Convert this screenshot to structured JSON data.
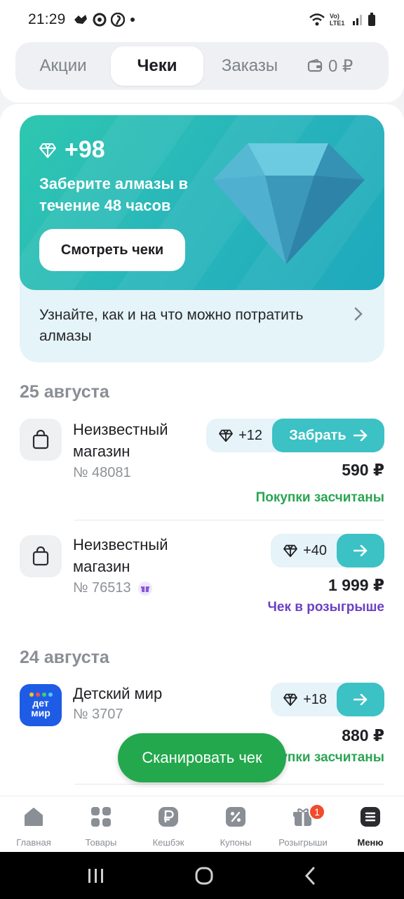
{
  "status_bar": {
    "time": "21:29",
    "network": "Vo) LTE1"
  },
  "tabs": [
    {
      "label": "Акции",
      "active": false
    },
    {
      "label": "Чеки",
      "active": true
    },
    {
      "label": "Заказы",
      "active": false
    }
  ],
  "wallet": {
    "balance": "0 ₽"
  },
  "promo": {
    "amount": "+98",
    "text": "Заберите алмазы в течение 48 часов",
    "button_label": "Смотреть чеки",
    "info": "Узнайте, как и на что можно потратить алмазы"
  },
  "groups": [
    {
      "date": "25 августа",
      "receipts": [
        {
          "shop": "Неизвестный магазин",
          "number": "№ 48081",
          "diamonds": "+12",
          "action_label": "Забрать",
          "price": "590 ₽",
          "status": "Покупки засчитаны",
          "status_color": "#2aa552"
        },
        {
          "shop": "Неизвестный магазин",
          "number": "№ 76513",
          "diamonds": "+40",
          "price": "1 999 ₽",
          "status": "Чек в розыгрыше",
          "status_color": "#6a3fc4"
        }
      ]
    },
    {
      "date": "24 августа",
      "receipts": [
        {
          "shop": "Детский мир",
          "logo_text": "дет мир",
          "number": "№ 3707",
          "diamonds": "+18",
          "price": "880 ₽",
          "status": "Покупки засчитаны",
          "status_color": "#2aa552"
        }
      ]
    }
  ],
  "scan_button": "Сканировать чек",
  "bottom_nav": [
    {
      "label": "Главная",
      "icon": "home-icon"
    },
    {
      "label": "Товары",
      "icon": "grid-icon"
    },
    {
      "label": "Кешбэк",
      "icon": "ruble-icon"
    },
    {
      "label": "Купоны",
      "icon": "percent-icon"
    },
    {
      "label": "Розыгрыши",
      "icon": "gift-icon",
      "badge": "1"
    },
    {
      "label": "Меню",
      "icon": "menu-icon",
      "active": true
    }
  ],
  "colors": {
    "accent_teal": "#3cc1c5",
    "green": "#23a84d",
    "purple": "#6a3fc4"
  }
}
